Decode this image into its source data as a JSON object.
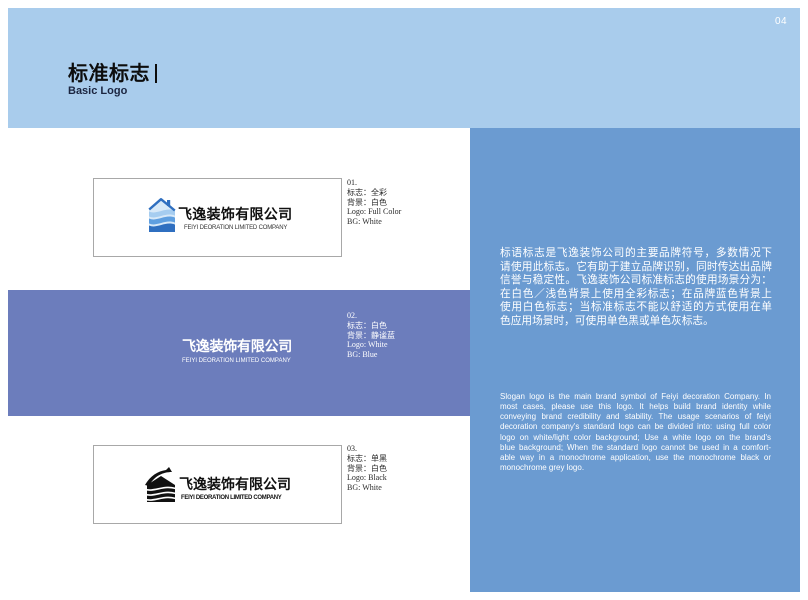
{
  "page": {
    "number": "04"
  },
  "header": {
    "title": "标准标志",
    "subtitle": "Basic Logo"
  },
  "logo_variants": [
    {
      "index": "01.",
      "logo_cn": "标志：全彩",
      "bg_cn": "背景：白色",
      "logo_en": "Logo: Full Color",
      "bg_en": "BG: White",
      "logo": {
        "icon": "house-wave-icon",
        "name_cn": "飞逸装饰有限公司",
        "name_en": "FEIYI DEORATION LIMITED COMPANY"
      }
    },
    {
      "index": "02.",
      "logo_cn": "标志：白色",
      "bg_cn": "背景：静谧蓝",
      "logo_en": "Logo: White",
      "bg_en": "BG: Blue",
      "logo": {
        "name_cn": "飞逸装饰有限公司",
        "name_en": "FEIYI DEORATION LIMITED COMPANY"
      }
    },
    {
      "index": "03.",
      "logo_cn": "标志：单黑",
      "bg_cn": "背景：白色",
      "logo_en": "Logo: Black",
      "bg_en": "BG: White",
      "logo": {
        "icon": "house-wave-icon-black",
        "name_cn": "飞逸装饰有限公司",
        "name_en": "FEIYI DEORATION LIMITED COMPANY"
      }
    }
  ],
  "description": {
    "cn_lines": [
      "标语标志是飞逸装饰公司的主要品牌符号，多数情况下",
      "请使用此标志。它有助于建立品牌识别，同时传达出品牌",
      "信誉与稳定性。飞逸装饰公司标准标志的使用场景分为：",
      "在白色／浅色背景上使用全彩标志；在品牌蓝色背景上",
      "使用白色标志；当标准标志不能以舒适的方式使用在单",
      "色应用场景时，可使用单色黑或单色灰标志。"
    ],
    "en_lines": [
      "Slogan logo is the main brand symbol of Feiyi decoration Company. In",
      "most cases, please use this logo. It helps build brand identity while",
      "conveying brand credibility and stability. The usage scenarios of feiyi",
      "decoration company's standard logo can be divided into: using full color",
      "logo on white/light color background; Use a white logo on the brand's",
      "blue background; When the standard logo cannot be used in a comfort-",
      "able way in a monochrome application, use the monochrome black or",
      "monochrome grey logo."
    ]
  },
  "colors": {
    "banner": "#a9ccec",
    "panel": "#6b9bd1",
    "band": "#6c7dbc",
    "box_border": "#a8a8a8",
    "logo_blue": "#2f6fc0",
    "logo_black": "#111111",
    "text_white": "#ffffff"
  }
}
